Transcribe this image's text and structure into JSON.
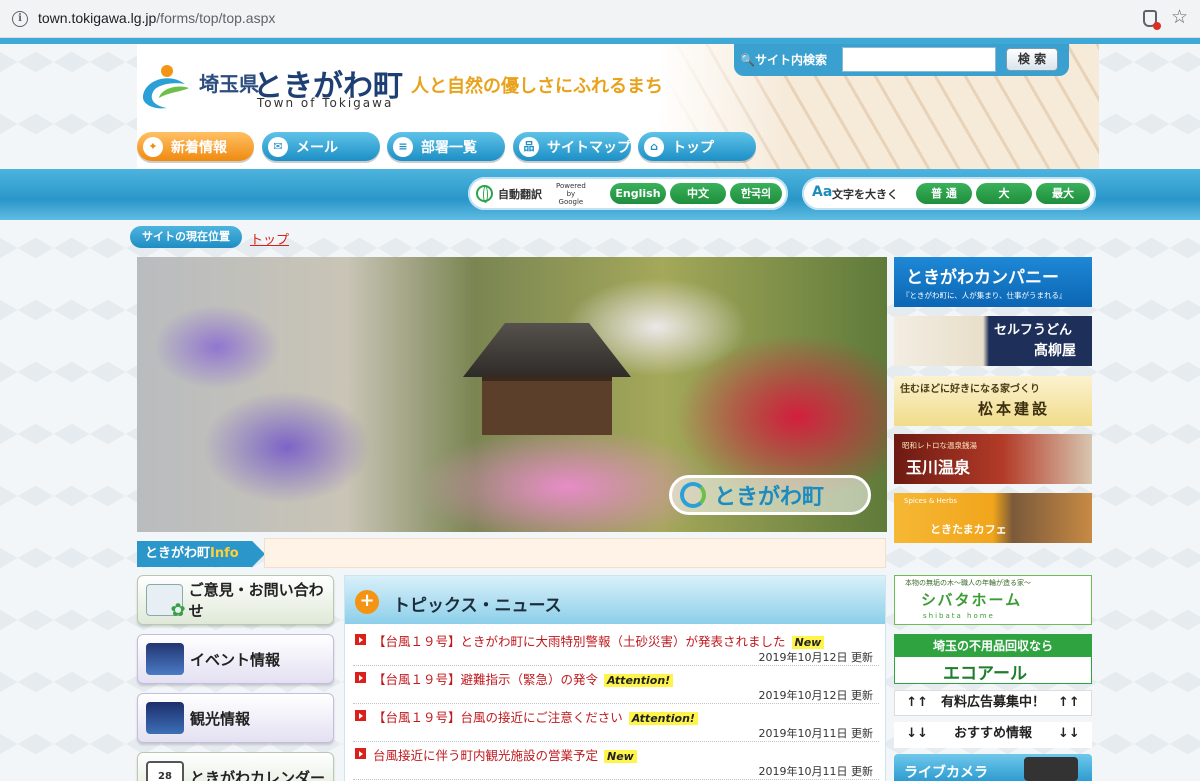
{
  "browser": {
    "url_host": "town.tokigawa.lg.jp",
    "url_path": "/forms/top/top.aspx"
  },
  "header": {
    "logo_pref": "埼玉県",
    "logo_town": "ときがわ町",
    "logo_en": "Town of Tokigawa",
    "slogan": "人と自然の優しさにふれるまち",
    "search_label": "サイト内検索",
    "search_button": "検 索",
    "search_value": ""
  },
  "nav": [
    {
      "label": "新着情報",
      "icon": "star-icon"
    },
    {
      "label": "メール",
      "icon": "mail-icon"
    },
    {
      "label": "部署一覧",
      "icon": "list-icon"
    },
    {
      "label": "サイトマップ",
      "icon": "sitemap-icon"
    },
    {
      "label": "トップ",
      "icon": "home-icon"
    }
  ],
  "translate": {
    "label": "自動翻訳",
    "powered_line1": "Powered",
    "powered_line2": "by",
    "powered_line3": "Google",
    "english": "English",
    "chinese": "中文",
    "korean": "한국의"
  },
  "fontsize": {
    "label": "文字を大きく",
    "normal": "普 通",
    "large": "大",
    "largest": "最大"
  },
  "breadcrumb": {
    "label": "サイトの現在位置",
    "link": "トップ"
  },
  "hero": {
    "badge": "ときがわ町"
  },
  "info": {
    "label_prefix": "ときがわ町",
    "label_highlight": "Info"
  },
  "left_menu": [
    {
      "label": "ご意見・お問い合わせ",
      "icon": "mail-clover-icon"
    },
    {
      "label": "イベント情報",
      "icon": "observatory-icon"
    },
    {
      "label": "観光情報",
      "icon": "landscape-icon"
    },
    {
      "label": "ときがわカレンダー",
      "icon": "calendar-icon",
      "icon_text": "28"
    }
  ],
  "topics": {
    "title": "トピックス・ニュース",
    "items": [
      {
        "title": "【台風１９号】ときがわ町に大雨特別警報（土砂災害）が発表されました",
        "badge": "New",
        "date": "2019年10月12日 更新"
      },
      {
        "title": "【台風１９号】避難指示（緊急）の発令",
        "badge": "Attention!",
        "date": "2019年10月12日 更新"
      },
      {
        "title": "【台風１９号】台風の接近にご注意ください",
        "badge": "Attention!",
        "date": "2019年10月11日 更新"
      },
      {
        "title": "台風接近に伴う町内観光施設の営業予定",
        "badge": "New",
        "date": "2019年10月11日 更新"
      }
    ]
  },
  "banners": {
    "company_title": "ときがわカンパニー",
    "company_sub": "『ときがわ町に、人が集まり、仕事がうまれる』",
    "udon_title": "セルフうどん",
    "udon_name": "髙柳屋",
    "matsumoto_tag": "住むほどに好きになる家づくり",
    "matsumoto_name": "松本建設",
    "onsen_tag": "昭和レトロな温泉銭湯",
    "onsen_name": "玉川温泉",
    "cafe_tag": "Spices & Herbs",
    "cafe_name": "ときたまカフェ",
    "shibata_tag": "本物の無垢の木～職人の年輪が造る家～",
    "shibata_name": "シバタホーム",
    "shibata_en": "shibata home",
    "eco_tag": "埼玉の不用品回収なら",
    "eco_name": "エコアール",
    "ad_wanted": "↑↑　有料広告募集中！　↑↑",
    "recommend": "↓↓　　おすすめ情報　　↓↓",
    "livecam": "ライブカメラ"
  },
  "colors": {
    "accent_blue": "#2a96c9",
    "accent_orange": "#f08a10",
    "green": "#2ea340",
    "news_red": "#c0191d"
  }
}
